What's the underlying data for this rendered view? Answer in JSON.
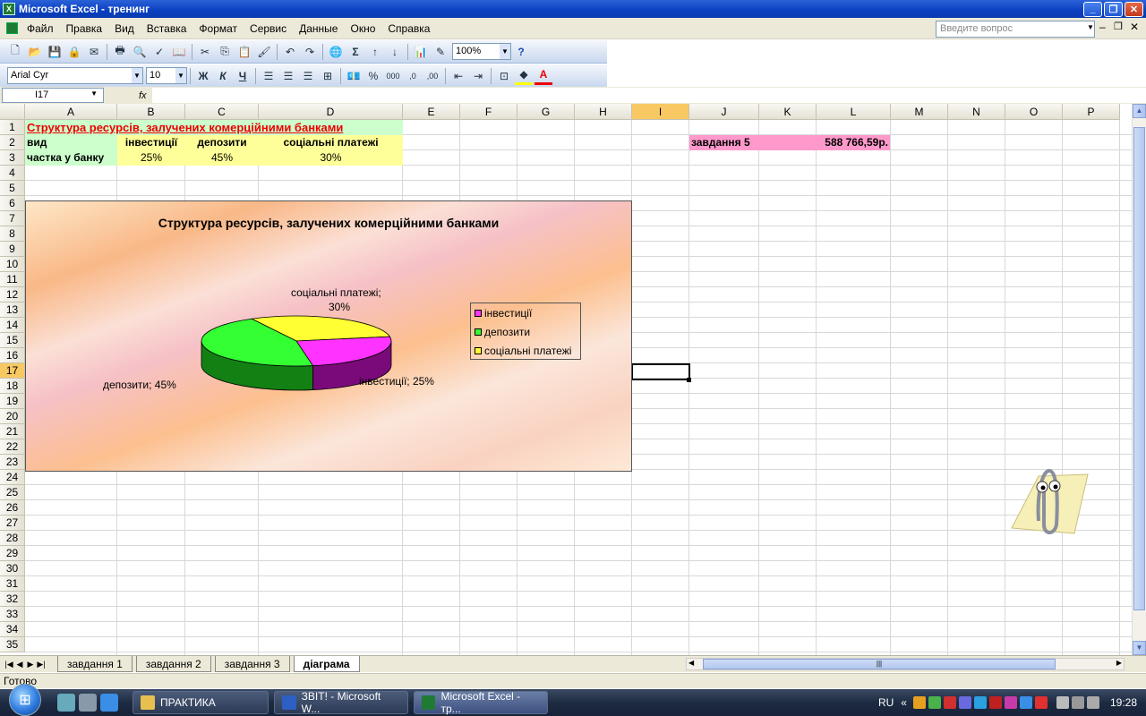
{
  "window": {
    "title": "Microsoft Excel - тренинг",
    "app_icon": "X"
  },
  "menu": {
    "items": [
      "Файл",
      "Правка",
      "Вид",
      "Вставка",
      "Формат",
      "Сервис",
      "Данные",
      "Окно",
      "Справка"
    ],
    "ask_placeholder": "Введите вопрос"
  },
  "toolbar": {
    "zoom": "100%",
    "font": "Arial Cyr",
    "size": "10",
    "bold": "Ж",
    "italic": "К",
    "underline": "Ч"
  },
  "formula": {
    "name_box": "I17",
    "fx": "fx",
    "value": ""
  },
  "columns": [
    "A",
    "B",
    "C",
    "D",
    "E",
    "F",
    "G",
    "H",
    "I",
    "J",
    "K",
    "L",
    "M",
    "N",
    "O",
    "P"
  ],
  "rows": [
    "1",
    "2",
    "3",
    "4",
    "5",
    "6",
    "7",
    "8",
    "9",
    "10",
    "11",
    "12",
    "13",
    "14",
    "15",
    "16",
    "17",
    "18",
    "19",
    "20",
    "21",
    "22",
    "23",
    "24",
    "25",
    "26",
    "27",
    "28",
    "29",
    "30",
    "31",
    "32",
    "33",
    "34",
    "35"
  ],
  "sheet": {
    "a1": "Структура ресурсів, залучених комерційними банками",
    "a2": "вид",
    "b2": "інвестиції",
    "c2": "депозити",
    "d2": "соціальні платежі",
    "a3": "частка у банку",
    "b3": "25%",
    "c3": "45%",
    "d3": "30%",
    "j2": "завдання 5",
    "l2": "588 766,59р.",
    "selected_cell": "I17"
  },
  "chart_data": {
    "type": "pie",
    "title": "Структура ресурсів, залучених комерційними банками",
    "categories": [
      "інвестиції",
      "депозити",
      "соціальні платежі"
    ],
    "values": [
      25,
      45,
      30
    ],
    "colors": [
      "#ff33ff",
      "#33ff33",
      "#ffff33"
    ],
    "side_colors": [
      "#7a0a7a",
      "#138013",
      "#a3a300"
    ],
    "labels": [
      "інвестиції; 25%",
      "депозити; 45%",
      "соціальні платежі;",
      "30%"
    ],
    "legend": [
      "інвестиції",
      "депозити",
      "соціальні платежі"
    ],
    "legend_placement": "right",
    "three_d": true
  },
  "tabs": [
    "завдання 1",
    "завдання 2",
    "завдання 3",
    "діаграма"
  ],
  "active_tab": "діаграма",
  "status": "Готово",
  "taskbar": {
    "apps": [
      "ПРАКТИКА",
      "ЗВІТ! - Microsoft W...",
      "Microsoft Excel - тр..."
    ],
    "lang": "RU",
    "time": "19:28"
  }
}
